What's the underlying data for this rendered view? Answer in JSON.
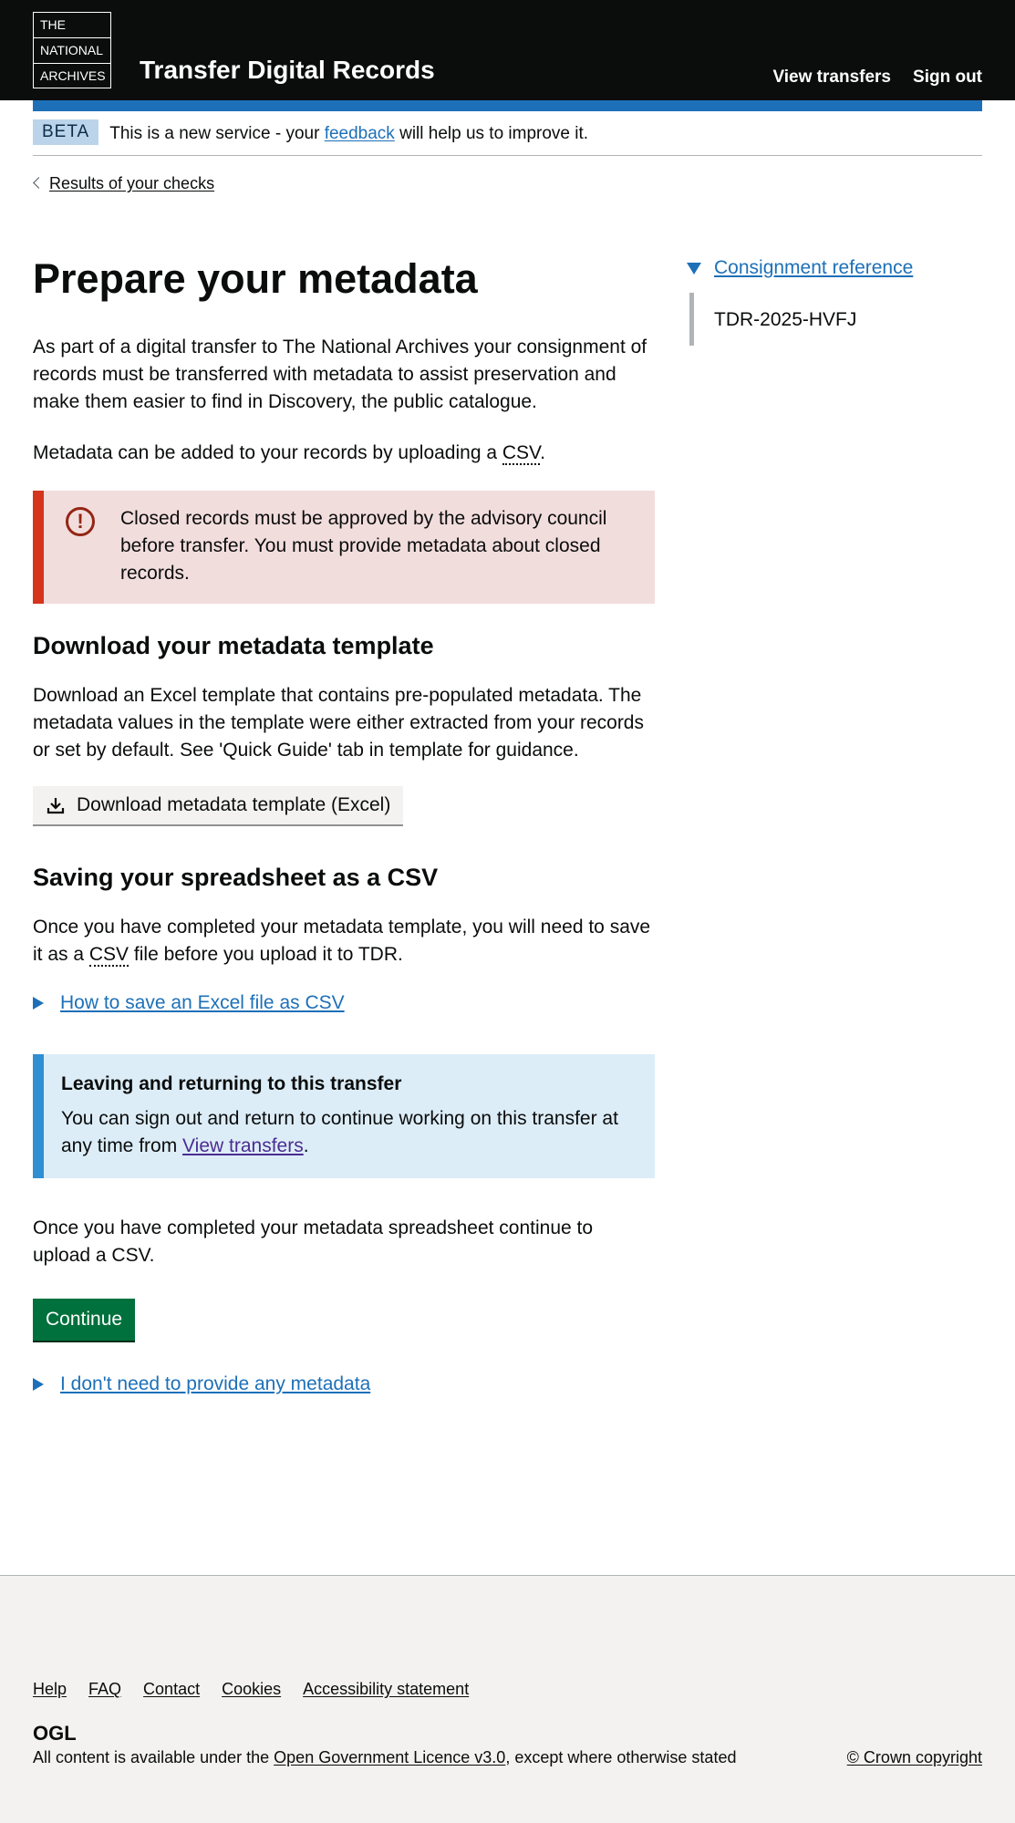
{
  "header": {
    "logo_lines": [
      "THE",
      "NATIONAL",
      "ARCHIVES"
    ],
    "service_name": "Transfer Digital Records",
    "nav": {
      "view_transfers": "View transfers",
      "sign_out": "Sign out"
    }
  },
  "beta_banner": {
    "tag": "BETA",
    "text_before": "This is a new service - your ",
    "feedback_link": "feedback",
    "text_after": " will help us to improve it."
  },
  "back_link": "Results of your checks",
  "main": {
    "title": "Prepare your metadata",
    "intro": "As part of a digital transfer to The National Archives your consignment of records must be transferred with metadata to assist preservation and make them easier to find in Discovery, the public catalogue.",
    "csv_para_before": "Metadata can be added to your records by uploading a ",
    "csv_abbr": "CSV",
    "csv_para_after": ".",
    "warning": {
      "icon": "!",
      "text": "Closed records must be approved by the advisory council before transfer. You must provide metadata about closed records."
    },
    "download_section": {
      "heading": "Download your metadata template",
      "body": "Download an Excel template that contains pre-populated metadata. The metadata values in the template were either extracted from your records or set by default. See 'Quick Guide' tab in template for guidance.",
      "button": "Download metadata template (Excel)"
    },
    "saving_section": {
      "heading": "Saving your spreadsheet as a CSV",
      "body_before": "Once you have completed your metadata template, you will need to save it as a ",
      "body_abbr": "CSV",
      "body_after": " file before you upload it to TDR.",
      "details_summary": "How to save an Excel file as CSV"
    },
    "inset": {
      "title": "Leaving and returning to this transfer",
      "text_before": "You can sign out and return to continue working on this transfer at any time from ",
      "link": "View transfers",
      "text_after": "."
    },
    "closing": "Once you have completed your metadata spreadsheet continue to upload a CSV.",
    "continue_button": "Continue",
    "no_metadata_link": "I don't need to provide any metadata"
  },
  "aside": {
    "summary": "Consignment reference",
    "reference": "TDR-2025-HVFJ"
  },
  "footer": {
    "links": [
      "Help",
      "FAQ",
      "Contact",
      "Cookies",
      "Accessibility statement"
    ],
    "ogl": "OGL",
    "licence_before": "All content is available under the ",
    "licence_link": "Open Government Licence v3.0",
    "licence_after": ", except where otherwise stated",
    "copyright": "© Crown copyright"
  },
  "colors": {
    "header_bg": "#0b0c0c",
    "accent_blue": "#1d70b8",
    "warning_red": "#d4351c",
    "continue_green": "#00703c",
    "inset_blue": "#2f8fd2"
  }
}
